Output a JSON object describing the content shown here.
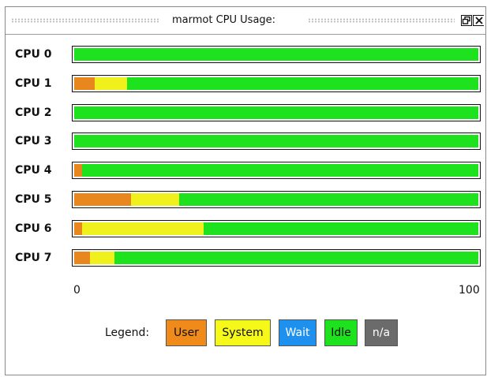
{
  "window": {
    "title": "marmot CPU Usage:"
  },
  "cpus": [
    {
      "label": "CPU 0",
      "user": 0,
      "system": 0,
      "wait": 0,
      "idle": 100
    },
    {
      "label": "CPU 1",
      "user": 5,
      "system": 8,
      "wait": 0,
      "idle": 87
    },
    {
      "label": "CPU 2",
      "user": 0,
      "system": 0,
      "wait": 0,
      "idle": 100
    },
    {
      "label": "CPU 3",
      "user": 0,
      "system": 0,
      "wait": 0,
      "idle": 100
    },
    {
      "label": "CPU 4",
      "user": 2,
      "system": 0,
      "wait": 0,
      "idle": 98
    },
    {
      "label": "CPU 5",
      "user": 14,
      "system": 12,
      "wait": 0,
      "idle": 74
    },
    {
      "label": "CPU 6",
      "user": 2,
      "system": 30,
      "wait": 0,
      "idle": 68
    },
    {
      "label": "CPU 7",
      "user": 4,
      "system": 6,
      "wait": 0,
      "idle": 90
    }
  ],
  "axis": {
    "min_label": "0",
    "max_label": "100"
  },
  "legend": {
    "title": "Legend:",
    "items": [
      {
        "label": "User",
        "color": "#f08a1a"
      },
      {
        "label": "System",
        "color": "#f6f81a"
      },
      {
        "label": "Wait",
        "color": "#1e90ee"
      },
      {
        "label": "Idle",
        "color": "#1ee21e"
      },
      {
        "label": "n/a",
        "color": "#6b6b6b"
      }
    ]
  },
  "chart_data": {
    "type": "bar",
    "orientation": "horizontal",
    "stacked": true,
    "categories": [
      "CPU 0",
      "CPU 1",
      "CPU 2",
      "CPU 3",
      "CPU 4",
      "CPU 5",
      "CPU 6",
      "CPU 7"
    ],
    "series": [
      {
        "name": "User",
        "values": [
          0,
          5,
          0,
          0,
          2,
          14,
          2,
          4
        ]
      },
      {
        "name": "System",
        "values": [
          0,
          8,
          0,
          0,
          0,
          12,
          30,
          6
        ]
      },
      {
        "name": "Wait",
        "values": [
          0,
          0,
          0,
          0,
          0,
          0,
          0,
          0
        ]
      },
      {
        "name": "Idle",
        "values": [
          100,
          87,
          100,
          100,
          98,
          74,
          68,
          90
        ]
      }
    ],
    "xlim": [
      0,
      100
    ],
    "tick_labels": [
      "0",
      "100"
    ],
    "legend_position": "bottom"
  }
}
